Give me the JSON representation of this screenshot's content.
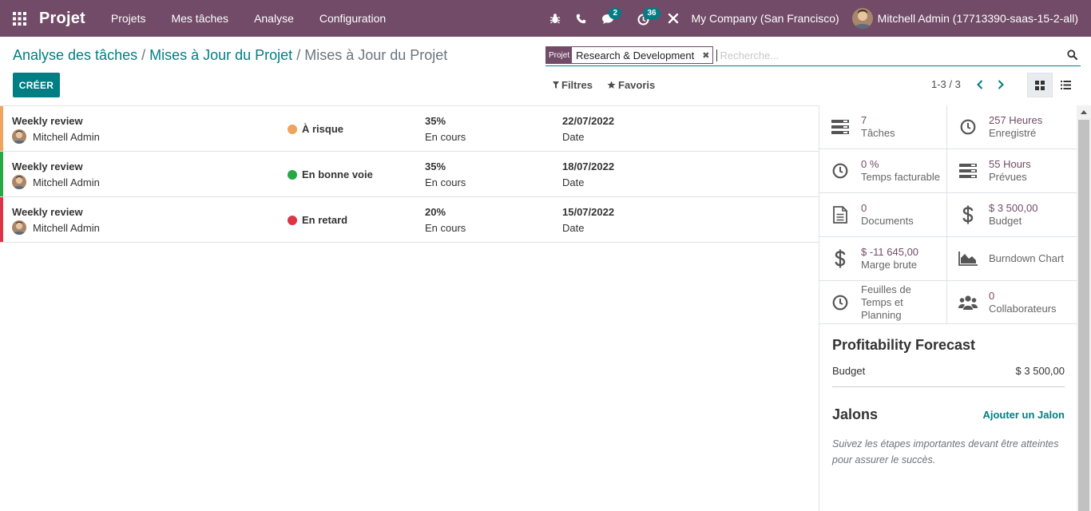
{
  "navbar": {
    "brand": "Projet",
    "menu": [
      "Projets",
      "Mes tâches",
      "Analyse",
      "Configuration"
    ],
    "messages_count": "2",
    "activities_count": "36",
    "company": "My Company (San Francisco)",
    "user": "Mitchell Admin (17713390-saas-15-2-all)"
  },
  "breadcrumb": {
    "items": [
      "Analyse des tâches",
      "Mises à Jour du Projet"
    ],
    "separator": "/",
    "active": "Mises à Jour du Projet"
  },
  "actions": {
    "create_label": "CRÉER"
  },
  "search": {
    "facet_type": "Projet",
    "facet_value": "Research & Development",
    "facet_remove": "✖",
    "placeholder": "Recherche..."
  },
  "filters": {
    "filters_label": "Filtres",
    "favorites_label": "Favoris"
  },
  "pager": {
    "value": "1-3 / 3"
  },
  "colors": {
    "brand": "#714b67",
    "accent": "#017e84",
    "at_risk": "#f0a35c",
    "on_track": "#28a745",
    "late": "#dc3545"
  },
  "updates": [
    {
      "title": "Weekly review",
      "owner": "Mitchell Admin",
      "status": "À risque",
      "status_color": "#f0a35c",
      "progress": "35%",
      "progress_label": "En cours",
      "date": "22/07/2022",
      "date_label": "Date"
    },
    {
      "title": "Weekly review",
      "owner": "Mitchell Admin",
      "status": "En bonne voie",
      "status_color": "#28a745",
      "progress": "35%",
      "progress_label": "En cours",
      "date": "18/07/2022",
      "date_label": "Date"
    },
    {
      "title": "Weekly review",
      "owner": "Mitchell Admin",
      "status": "En retard",
      "status_color": "#dc3545",
      "progress": "20%",
      "progress_label": "En cours",
      "date": "15/07/2022",
      "date_label": "Date"
    }
  ],
  "stats": [
    {
      "icon": "tasks-icon",
      "value": "7",
      "label": "Tâches"
    },
    {
      "icon": "clock-icon",
      "value": "257 Heures",
      "label": "Enregistré"
    },
    {
      "icon": "clock-icon",
      "value": "0 %",
      "label": "Temps facturable"
    },
    {
      "icon": "tasks-icon",
      "value": "55 Hours",
      "label": "Prévues"
    },
    {
      "icon": "document-icon",
      "value": "0",
      "label": "Documents"
    },
    {
      "icon": "dollar-icon",
      "value": "$ 3 500,00",
      "label": "Budget"
    },
    {
      "icon": "dollar-icon",
      "value": "$ -11 645,00",
      "label": "Marge brute"
    },
    {
      "icon": "area-chart-icon",
      "value": "",
      "label": "Burndown Chart"
    },
    {
      "icon": "clock-icon",
      "value": "",
      "label": "Feuilles de Temps et Planning"
    },
    {
      "icon": "users-icon",
      "value": "0",
      "label": "Collaborateurs"
    }
  ],
  "forecast": {
    "title": "Profitability Forecast",
    "budget_label": "Budget",
    "budget_value": "$ 3 500,00"
  },
  "milestones": {
    "title": "Jalons",
    "add_label": "Ajouter un Jalon",
    "help": "Suivez les étapes importantes devant être atteintes pour assurer le succès."
  }
}
